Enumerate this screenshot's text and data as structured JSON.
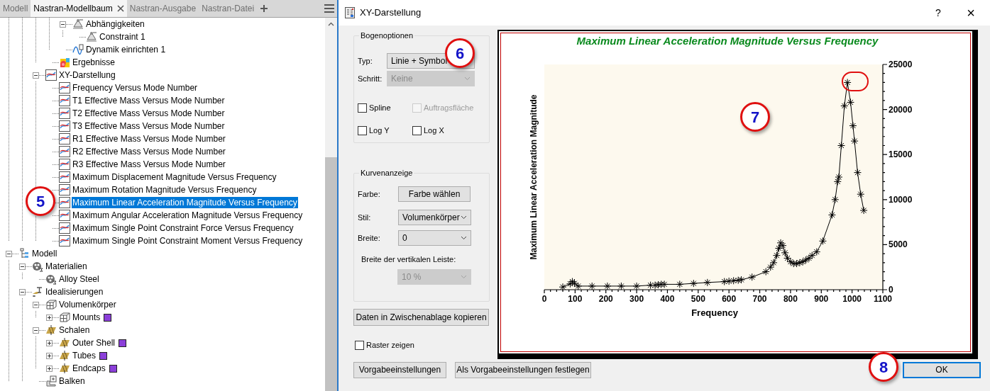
{
  "panel_tabs": [
    {
      "label": "Modell",
      "selected": false,
      "closable": false
    },
    {
      "label": "Nastran-Modellbaum",
      "selected": true,
      "closable": true
    },
    {
      "label": "Nastran-Ausgabe",
      "selected": false,
      "closable": false
    },
    {
      "label": "Nastran-Datei",
      "selected": false,
      "closable": false
    }
  ],
  "tree": {
    "items": [
      {
        "children": [
          {
            "children": [
              {
                "children": [
                  {
                    "children": [
                      {
                        "label": "Abhängigkeiten",
                        "kind": "constraint",
                        "selected": false,
                        "expanded": true,
                        "children": [
                          {
                            "label": "Constraint 1",
                            "kind": "constraint",
                            "selected": false
                          }
                        ]
                      },
                      {
                        "label": "Dynamik einrichten 1",
                        "kind": "dynamics",
                        "selected": false
                      }
                    ]
                  },
                  {
                    "label": "Ergebnisse",
                    "kind": "results",
                    "selected": false
                  }
                ]
              },
              {
                "label": "XY-Darstellung",
                "kind": "chart",
                "selected": false,
                "expanded": true,
                "children": [
                  {
                    "label": "Frequency Versus Mode Number",
                    "kind": "chart",
                    "selected": false
                  },
                  {
                    "label": "T1 Effective Mass Versus Mode Number",
                    "kind": "chart",
                    "selected": false
                  },
                  {
                    "label": "T2 Effective Mass Versus Mode Number",
                    "kind": "chart",
                    "selected": false
                  },
                  {
                    "label": "T3 Effective Mass Versus Mode Number",
                    "kind": "chart",
                    "selected": false
                  },
                  {
                    "label": "R1 Effective Mass Versus Mode Number",
                    "kind": "chart",
                    "selected": false
                  },
                  {
                    "label": "R2 Effective Mass Versus Mode Number",
                    "kind": "chart",
                    "selected": false
                  },
                  {
                    "label": "R3 Effective Mass Versus Mode Number",
                    "kind": "chart",
                    "selected": false
                  },
                  {
                    "label": "Maximum Displacement Magnitude Versus Frequency",
                    "kind": "chart",
                    "selected": false
                  },
                  {
                    "label": "Maximum Rotation Magnitude Versus Frequency",
                    "kind": "chart",
                    "selected": false
                  },
                  {
                    "label": "Maximum Linear Acceleration Magnitude Versus Frequency",
                    "kind": "chart",
                    "selected": true
                  },
                  {
                    "label": "Maximum Angular Acceleration Magnitude Versus Frequency",
                    "kind": "chart",
                    "selected": false
                  },
                  {
                    "label": "Maximum Single Point Constraint Force Versus Frequency",
                    "kind": "chart",
                    "selected": false
                  },
                  {
                    "label": "Maximum Single Point Constraint Moment Versus Frequency",
                    "kind": "chart",
                    "selected": false
                  }
                ]
              }
            ]
          }
        ]
      },
      {
        "label": "Modell",
        "kind": "model",
        "selected": false,
        "expanded": true,
        "children": [
          {
            "label": "Materialien",
            "kind": "material",
            "selected": false,
            "expanded": true,
            "children": [
              {
                "label": "Alloy Steel",
                "kind": "material",
                "selected": false
              }
            ]
          },
          {
            "label": "Idealisierungen",
            "kind": "idealization",
            "selected": false,
            "expanded": true,
            "children": [
              {
                "label": "Volumenkörper",
                "kind": "solid",
                "selected": false,
                "expanded": true,
                "children": [
                  {
                    "label": "Mounts",
                    "kind": "solid",
                    "selected": false,
                    "expanded": false,
                    "color": "#8b3fd9"
                  }
                ]
              },
              {
                "label": "Schalen",
                "kind": "shell",
                "selected": false,
                "expanded": true,
                "children": [
                  {
                    "label": "Outer Shell",
                    "kind": "shell",
                    "selected": false,
                    "expanded": false,
                    "color": "#8b3fd9"
                  },
                  {
                    "label": "Tubes",
                    "kind": "shell",
                    "selected": false,
                    "expanded": false,
                    "color": "#8b3fd9"
                  },
                  {
                    "label": "Endcaps",
                    "kind": "shell",
                    "selected": false,
                    "expanded": false,
                    "color": "#8b3fd9"
                  }
                ]
              },
              {
                "label": "Balken",
                "kind": "beam",
                "selected": false
              }
            ]
          }
        ]
      }
    ]
  },
  "dialog": {
    "title": "XY-Darstellung",
    "help": "?",
    "close": "×",
    "curve_options": {
      "title": "Bogenoptionen",
      "type": {
        "label": "Typ:",
        "value": "Linie + Symbol",
        "disabled": false
      },
      "step": {
        "label": "Schritt:",
        "value": "Keine",
        "disabled": true
      },
      "checkboxes": [
        {
          "label": "Spline",
          "checked": false,
          "disabled": false
        },
        {
          "label": "Auftragsfläche",
          "checked": false,
          "disabled": true
        },
        {
          "label": "Log Y",
          "checked": false,
          "disabled": false
        },
        {
          "label": "Log X",
          "checked": false,
          "disabled": false
        }
      ]
    },
    "curve_display": {
      "title": "Kurvenanzeige",
      "color_label": "Farbe:",
      "color_button": "Farbe wählen",
      "style": {
        "label": "Stil:",
        "value": "Volumenkörper",
        "disabled": false
      },
      "width": {
        "label": "Breite:",
        "value": "0",
        "disabled": false
      },
      "bar_width_label": "Breite der vertikalen Leiste:",
      "bar_width": {
        "value": "10 %",
        "disabled": true
      }
    },
    "copy_button": "Daten in Zwischenablage kopieren",
    "grid_checkbox": {
      "label": "Raster zeigen",
      "checked": false
    },
    "buttons": [
      {
        "label": "Vorgabeeinstellungen",
        "default": false
      },
      {
        "label": "Als Vorgabeeinstellungen festlegen",
        "default": false
      },
      {
        "label": "OK",
        "default": true
      }
    ],
    "chart_data": {
      "type": "line",
      "title": "Maximum Linear Acceleration Magnitude Versus Frequency",
      "xlabel": "Frequency",
      "ylabel": "Maximum Linear Acceleration Magnitude",
      "x": [
        60,
        84,
        91,
        98,
        110,
        155,
        205,
        250,
        300,
        345,
        360,
        370,
        380,
        390,
        440,
        485,
        530,
        585,
        600,
        615,
        630,
        640,
        675,
        720,
        735,
        745,
        755,
        762,
        768,
        775,
        782,
        790,
        800,
        810,
        820,
        830,
        840,
        850,
        860,
        870,
        885,
        905,
        935,
        945,
        953,
        957,
        965,
        975,
        985,
        995,
        1003,
        1008,
        1018,
        1028,
        1038
      ],
      "series": [
        {
          "color": "#000000",
          "marker": "cross",
          "values": [
            300,
            650,
            900,
            700,
            400,
            400,
            400,
            400,
            400,
            500,
            500,
            550,
            600,
            600,
            600,
            700,
            800,
            900,
            950,
            1000,
            1050,
            1100,
            1400,
            2000,
            2500,
            3000,
            3800,
            4600,
            5200,
            4900,
            4100,
            3500,
            3100,
            2900,
            2900,
            3000,
            3100,
            3300,
            3500,
            3800,
            4200,
            5400,
            8300,
            10000,
            12000,
            12500,
            16000,
            20400,
            23000,
            20800,
            18200,
            16500,
            13000,
            10600,
            8800
          ]
        }
      ],
      "xlim": [
        0,
        1100
      ],
      "ylim": [
        0,
        25000
      ],
      "xticks": [
        0,
        100,
        200,
        300,
        400,
        500,
        600,
        700,
        800,
        900,
        1000,
        1100
      ],
      "yticks": [
        0,
        5000,
        10000,
        15000,
        20000,
        25000
      ]
    }
  },
  "callouts": [
    {
      "kind": "number",
      "label": "5"
    },
    {
      "kind": "number",
      "label": "6"
    },
    {
      "kind": "number",
      "label": "7"
    },
    {
      "kind": "ring"
    },
    {
      "kind": "number",
      "label": "8"
    }
  ]
}
